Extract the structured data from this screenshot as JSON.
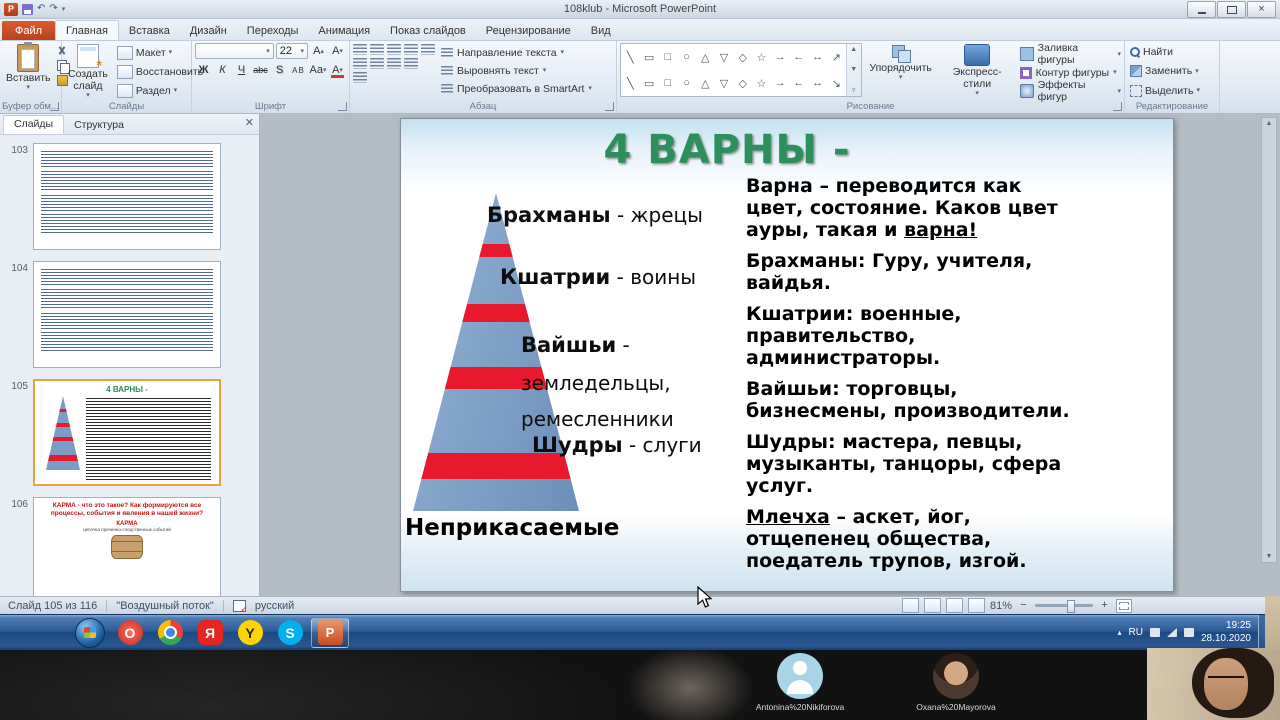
{
  "window": {
    "title": "108klub  -  Microsoft PowerPoint"
  },
  "ribbon": {
    "file_tab": "Файл",
    "active_tab": "Главная",
    "tabs": [
      "Главная",
      "Вставка",
      "Дизайн",
      "Переходы",
      "Анимация",
      "Показ слайдов",
      "Рецензирование",
      "Вид"
    ],
    "clipboard": {
      "group": "Буфер обм...",
      "paste": "Вставить"
    },
    "slides": {
      "group": "Слайды",
      "new_slide": "Создать слайд",
      "layout": "Макет",
      "reset": "Восстановить",
      "section": "Раздел"
    },
    "font": {
      "group": "Шрифт",
      "name": "",
      "size": "22",
      "bold": "Ж",
      "italic": "К",
      "underline": "Ч",
      "strike": "abc",
      "shadow": "S",
      "spacing": "АВ",
      "case": "Аа",
      "grow": "А",
      "shrink": "А",
      "color": "А"
    },
    "paragraph": {
      "group": "Абзац",
      "text_direction": "Направление текста",
      "align_text": "Выровнять текст",
      "smartart": "Преобразовать в SmartArt"
    },
    "drawing": {
      "group": "Рисование",
      "arrange": "Упорядочить",
      "quick_styles": "Экспресс-стили",
      "fill": "Заливка фигуры",
      "outline": "Контур фигуры",
      "effects": "Эффекты фигур",
      "shapes": [
        "╲",
        "▭",
        "□",
        "○",
        "△",
        "▽",
        "◇",
        "☆",
        "→",
        "←",
        "↔",
        "↗",
        "╲",
        "▭",
        "□",
        "○",
        "△",
        "▽",
        "◇",
        "☆",
        "→",
        "←",
        "↔",
        "↘"
      ]
    },
    "editing": {
      "group": "Редактирование",
      "find": "Найти",
      "replace": "Заменить",
      "select": "Выделить"
    }
  },
  "panel": {
    "tab_slides": "Слайды",
    "tab_outline": "Структура",
    "thumbnails": [
      {
        "number": "103",
        "type": "text"
      },
      {
        "number": "104",
        "type": "text"
      },
      {
        "number": "105",
        "type": "varny",
        "selected": true,
        "title": "4 ВАРНЫ -"
      },
      {
        "number": "106",
        "type": "karma",
        "title": "КАРМА - что это такое? Как формируются все процессы, события и явления в нашей жизни?",
        "subtitle": "КАРМА",
        "subtitle2": "цепочка причинно-следственных событий"
      }
    ]
  },
  "slide": {
    "title": "4 ВАРНЫ -",
    "pyramid": [
      {
        "name": "Брахманы",
        "desc": " - жрецы"
      },
      {
        "name": "Кшатрии",
        "desc": " - воины"
      },
      {
        "name": "Вайшьи",
        "desc": " - земледельцы,",
        "desc2": "ремесленники"
      },
      {
        "name": "Шудры",
        "desc": " - слуги"
      }
    ],
    "base": "Неприкасаемые",
    "paragraphs": [
      {
        "text": "Варна – переводится как цвет, состояние. Каков цвет ауры, такая и варна!",
        "u": "варна!"
      },
      {
        "text": "Брахманы: Гуру, учителя, вайдья."
      },
      {
        "text": "Кшатрии: военные, правительство, администраторы."
      },
      {
        "text": "Вайшьи: торговцы, бизнесмены, производители."
      },
      {
        "text": "Шудры: мастера, певцы, музыканты, танцоры, сфера услуг."
      },
      {
        "text": "Млечха – аскет, йог, отщепенец общества, поедатель трупов, изгой.",
        "u": "Млечха"
      }
    ]
  },
  "statusbar": {
    "slide_info": "Слайд 105 из 116",
    "theme": "\"Воздушный поток\"",
    "language": "русский",
    "zoom": "81%"
  },
  "taskbar": {
    "apps": [
      {
        "name": "start"
      },
      {
        "name": "opera",
        "letter": "O"
      },
      {
        "name": "chrome"
      },
      {
        "name": "yandex-browser",
        "letter": "Я"
      },
      {
        "name": "yandex-music",
        "letter": "Y"
      },
      {
        "name": "skype",
        "letter": "S"
      },
      {
        "name": "powerpoint",
        "letter": "P",
        "active": true
      }
    ],
    "tray": {
      "lang": "RU",
      "time": "19:25",
      "date": "28.10.2020"
    }
  },
  "conference": {
    "participants": [
      {
        "name": "Antonina%20Nikiforova",
        "type": "placeholder"
      },
      {
        "name": "Oxana%20Mayorova",
        "type": "photo"
      }
    ]
  },
  "colors": {
    "accent_title": "#2d8f5c",
    "pyramid_blue": "#7b9cc4",
    "stripe_red": "#e8192d",
    "selection_orange": "#e8a33d",
    "file_tab_orange": "#c8481f"
  }
}
